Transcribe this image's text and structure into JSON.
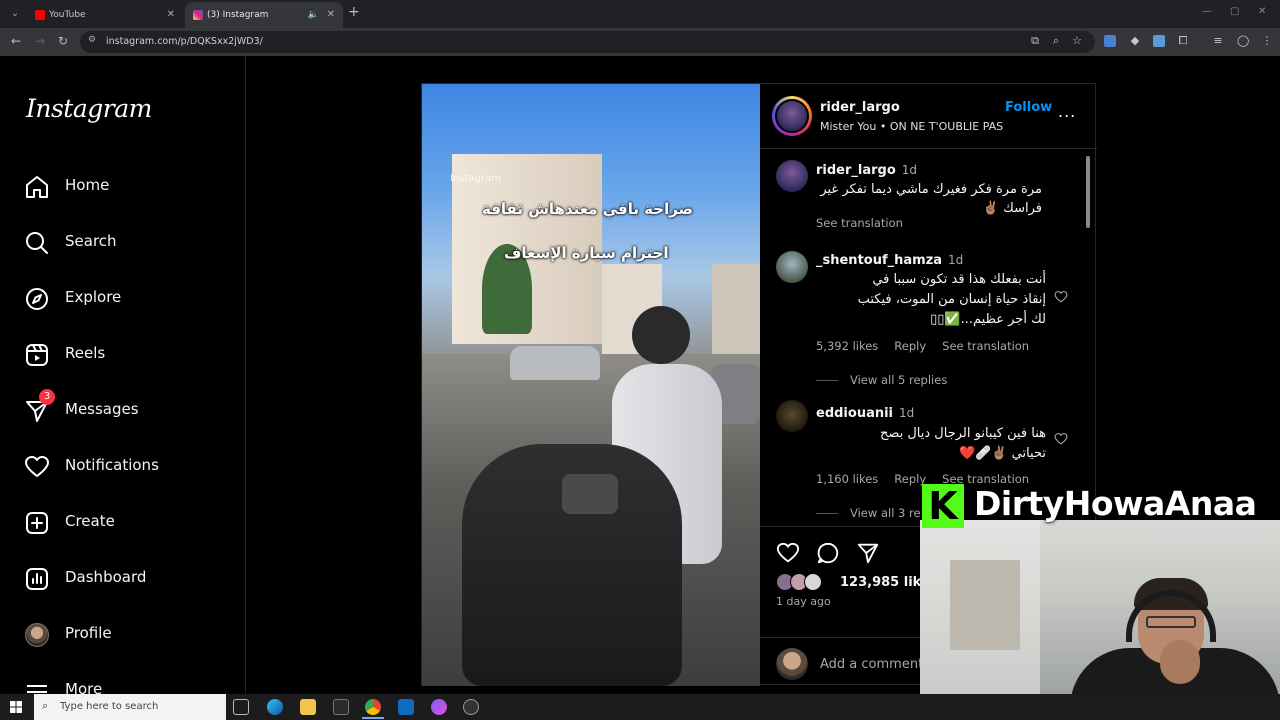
{
  "browser": {
    "tabs": [
      {
        "title": "YouTube",
        "color": "#ff0000"
      },
      {
        "title": "(3) Instagram",
        "color": "#d6249f"
      }
    ],
    "url": "instagram.com/p/DQKSxx2jWD3/"
  },
  "instagram": {
    "logo": "Instagram",
    "nav": [
      {
        "label": "Home",
        "icon": "home-icon"
      },
      {
        "label": "Search",
        "icon": "search-icon"
      },
      {
        "label": "Explore",
        "icon": "compass-icon"
      },
      {
        "label": "Reels",
        "icon": "reels-icon"
      },
      {
        "label": "Messages",
        "icon": "messenger-icon",
        "badge": "3"
      },
      {
        "label": "Notifications",
        "icon": "heart-icon"
      },
      {
        "label": "Create",
        "icon": "plus-square-icon"
      },
      {
        "label": "Dashboard",
        "icon": "dashboard-icon"
      },
      {
        "label": "Profile",
        "icon": "avatar"
      },
      {
        "label": "More",
        "icon": "menu-icon"
      }
    ]
  },
  "post": {
    "video": {
      "watermark": "Instagram",
      "caption_line1": "صراحة باقي معندهاش ثقافة",
      "caption_line2": "احترام سيارة الإسعاف"
    },
    "header": {
      "username": "rider_largo",
      "audio": "Mister You • ON NE T'OUBLIE PAS",
      "follow": "Follow",
      "more": "..."
    },
    "comments": [
      {
        "username": "rider_largo",
        "time": "1d",
        "text": "مرة مرة فكر فغيرك ماشي ديما تفكر غير فراسك ✌🏽",
        "see_translation": "See translation"
      },
      {
        "username": "_shentouf_hamza",
        "time": "1d",
        "text_line1": "أنت بفعلك هذا قد تكون سببا في",
        "text_line2": "إنقاذ حياة إنسان من الموت، فيكتب",
        "text_line3": "لك أجر عظيم...✅▯▯",
        "likes": "5,392 likes",
        "reply": "Reply",
        "see_translation": "See translation",
        "view_replies": "View all 5 replies"
      },
      {
        "username": "eddiouanii",
        "time": "1d",
        "text_line1": "هنا فين كيبانو الرجال ديال بصح",
        "text_line2": "تحياتي ✌🏽🩹❤️",
        "likes": "1,160 likes",
        "reply": "Reply",
        "see_translation": "See translation",
        "view_replies": "View all 3 re"
      }
    ],
    "likes_count": "123,985 likes",
    "posted_ago": "1 day ago",
    "add_comment_placeholder": "Add a comment"
  },
  "overlay": {
    "brand_letter": "K",
    "brand_name": "DirtyHowaAnaa",
    "brand_color": "#53fc18"
  },
  "taskbar": {
    "search_placeholder": "Type here to search"
  }
}
